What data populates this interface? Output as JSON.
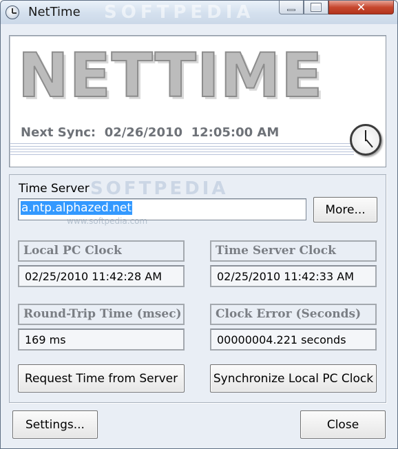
{
  "window": {
    "title": "NetTime",
    "watermark": "SOFTPEDIA",
    "close_glyph": "✕"
  },
  "banner": {
    "logo": "NETTIME",
    "next_sync_label": "Next Sync:",
    "next_sync_date": "02/26/2010",
    "next_sync_time": "12:05:00 AM"
  },
  "server": {
    "label": "Time Server",
    "value": "a.ntp.alphazed.net",
    "more_label": "More...",
    "watermark": "SOFTPEDIA",
    "watermark_small": "www.softpedia.com"
  },
  "clocks": {
    "local_caption": "Local PC Clock",
    "local_value": "02/25/2010  11:42:28 AM",
    "server_caption": "Time Server Clock",
    "server_value": "02/25/2010  11:42:33 AM",
    "rtt_caption": "Round-Trip Time (msec)",
    "rtt_value": "169 ms",
    "error_caption": "Clock Error (Seconds)",
    "error_value": "00000004.221 seconds"
  },
  "actions": {
    "request_label": "Request Time from Server",
    "sync_label": "Synchronize Local PC Clock",
    "settings_label": "Settings...",
    "close_label": "Close"
  },
  "icons": {
    "app": "clock-icon",
    "banner_clock": "clock-icon"
  }
}
